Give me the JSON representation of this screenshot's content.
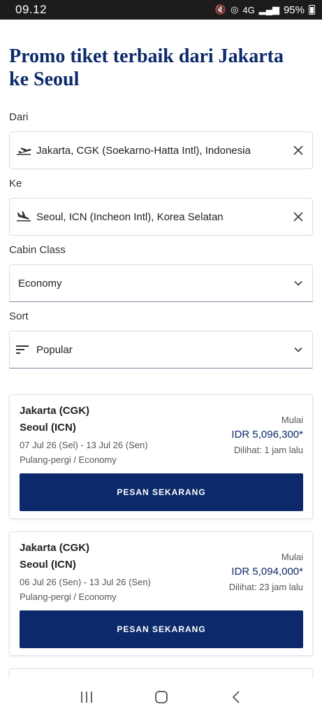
{
  "status": {
    "time": "09.12",
    "battery": "95%",
    "network": "4G"
  },
  "page": {
    "title": "Promo tiket terbaik dari Jakarta ke Seoul"
  },
  "form": {
    "from_label": "Dari",
    "from_value": "Jakarta, CGK (Soekarno-Hatta Intl), Indonesia",
    "to_label": "Ke",
    "to_value": "Seoul, ICN (Incheon Intl), Korea Selatan",
    "cabin_label": "Cabin Class",
    "cabin_value": "Economy",
    "sort_label": "Sort",
    "sort_value": "Popular"
  },
  "offers": [
    {
      "origin": "Jakarta (CGK)",
      "destination": "Seoul (ICN)",
      "dates": "07 Jul 26 (Sel) - 13 Jul 26 (Sen)",
      "trip": "Pulang-pergi / Economy",
      "from_label": "Mulai",
      "price": "IDR 5,096,300*",
      "seen": "Dilihat: 1 jam lalu",
      "button": "PESAN SEKARANG"
    },
    {
      "origin": "Jakarta (CGK)",
      "destination": "Seoul (ICN)",
      "dates": "06 Jul 26 (Sen) - 13 Jul 26 (Sen)",
      "trip": "Pulang-pergi / Economy",
      "from_label": "Mulai",
      "price": "IDR 5,094,000*",
      "seen": "Dilihat: 23 jam lalu",
      "button": "PESAN SEKARANG"
    }
  ],
  "icons": {
    "takeoff": "airplane-takeoff-icon",
    "landing": "airplane-landing-icon",
    "clear": "close-icon",
    "dropdown": "chevron-down-icon",
    "sort": "sort-icon"
  },
  "colors": {
    "brand": "#0c2a6b",
    "border": "#dadde2"
  }
}
